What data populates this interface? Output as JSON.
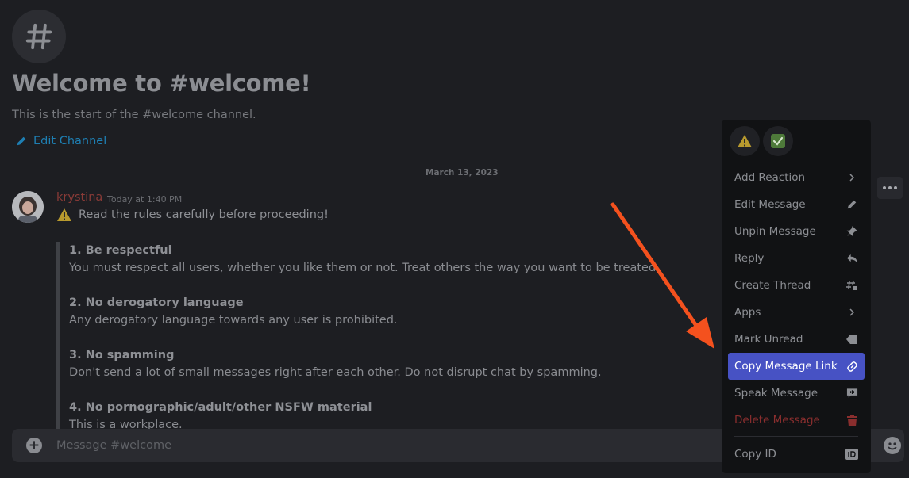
{
  "header": {
    "hash_icon": "hash-icon",
    "title": "Welcome to #welcome!",
    "subtitle": "This is the start of the #welcome channel.",
    "edit_channel": "Edit Channel"
  },
  "divider": {
    "date": "March 13, 2023"
  },
  "message": {
    "author": "krystina",
    "author_color": "#8a3b37",
    "timestamp": "Today at 1:40 PM",
    "first_line": "Read the rules carefully before proceeding!",
    "rules": [
      {
        "title": "1. Be respectful",
        "body": "You must respect all users, whether you like them or not. Treat others the way you want to be treated."
      },
      {
        "title": "2. No derogatory language",
        "body": "Any derogatory language towards any user is prohibited."
      },
      {
        "title": "3. No spamming",
        "body": "Don't send a lot of small messages right after each other. Do not disrupt chat by spamming."
      },
      {
        "title": "4. No pornographic/adult/other NSFW material",
        "body": "This is a workplace."
      }
    ]
  },
  "composer": {
    "placeholder": "Message #welcome"
  },
  "menu": {
    "reactions": [
      "warning-emoji",
      "check-mark-emoji"
    ],
    "items": [
      {
        "label": "Add Reaction",
        "icon": "chevron-right-icon"
      },
      {
        "label": "Edit Message",
        "icon": "pencil-icon"
      },
      {
        "label": "Unpin Message",
        "icon": "pin-icon"
      },
      {
        "label": "Reply",
        "icon": "reply-icon"
      },
      {
        "label": "Create Thread",
        "icon": "thread-icon"
      },
      {
        "label": "Apps",
        "icon": "chevron-right-icon"
      },
      {
        "label": "Mark Unread",
        "icon": "unread-icon"
      },
      {
        "label": "Copy Message Link",
        "icon": "link-icon",
        "active": true
      },
      {
        "label": "Speak Message",
        "icon": "speak-icon"
      },
      {
        "label": "Delete Message",
        "icon": "trash-icon",
        "danger": true
      },
      {
        "label": "Copy ID",
        "icon": "id-icon"
      }
    ]
  },
  "colors": {
    "accent": "#4752c4",
    "danger": "#8a2e2e",
    "link": "#1e7fb3",
    "annotation_arrow": "#f4511e"
  }
}
